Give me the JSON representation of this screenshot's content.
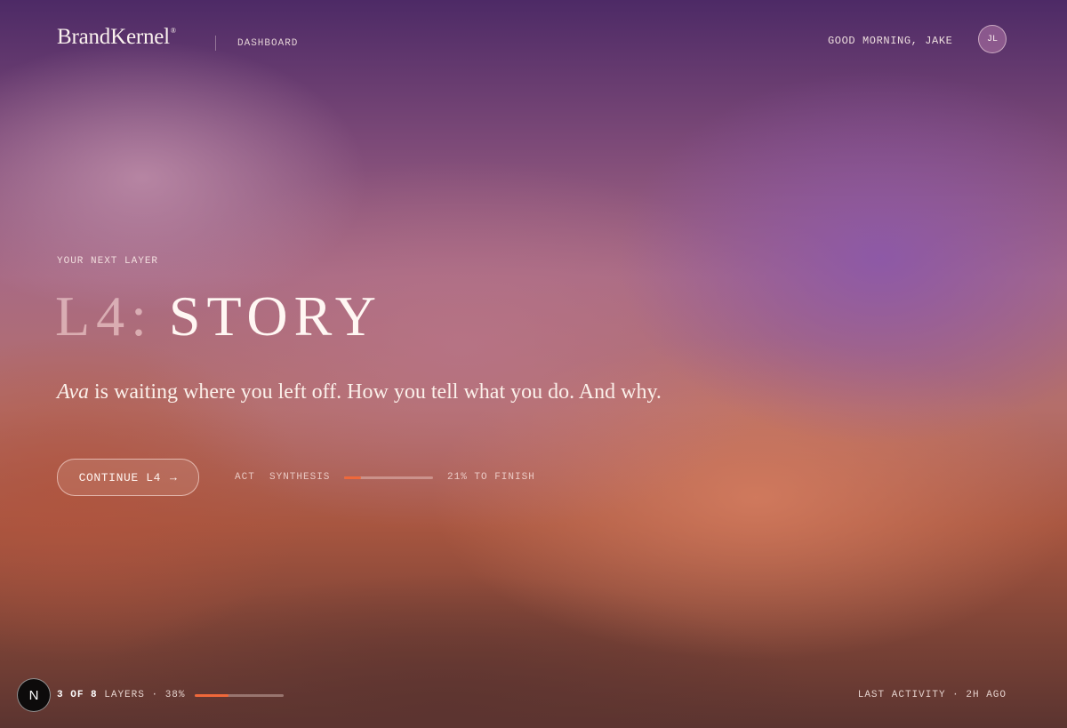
{
  "header": {
    "logo": "BrandKernel",
    "logo_mark": "®",
    "nav_label": "DASHBOARD",
    "greeting": "GOOD MORNING, JAKE",
    "avatar_initials": "JL"
  },
  "hero": {
    "eyebrow": "YOUR NEXT LAYER",
    "title_prefix": "L4:",
    "title_name": "STORY",
    "subtitle_name": "Ava",
    "subtitle_rest": " is waiting where you left off. How you tell what you do. And why."
  },
  "cta": {
    "button_label": "CONTINUE L4",
    "button_icon": "arrow-right-icon",
    "step_act": "ACT",
    "step_synthesis": "SYNTHESIS",
    "progress": 0.19,
    "progress_label": "21% TO FINISH"
  },
  "footer": {
    "badge_letter": "N",
    "layers_current": "3",
    "layers_of": "OF",
    "layers_total": "8",
    "layers_word": "LAYERS",
    "separator": "·",
    "layers_percent": "38%",
    "layers_progress": 0.38,
    "last_activity_label": "LAST ACTIVITY",
    "last_activity_value": "2H AGO"
  },
  "colors": {
    "accent": "#f0683a",
    "badge_bg": "#0d0b0b"
  }
}
